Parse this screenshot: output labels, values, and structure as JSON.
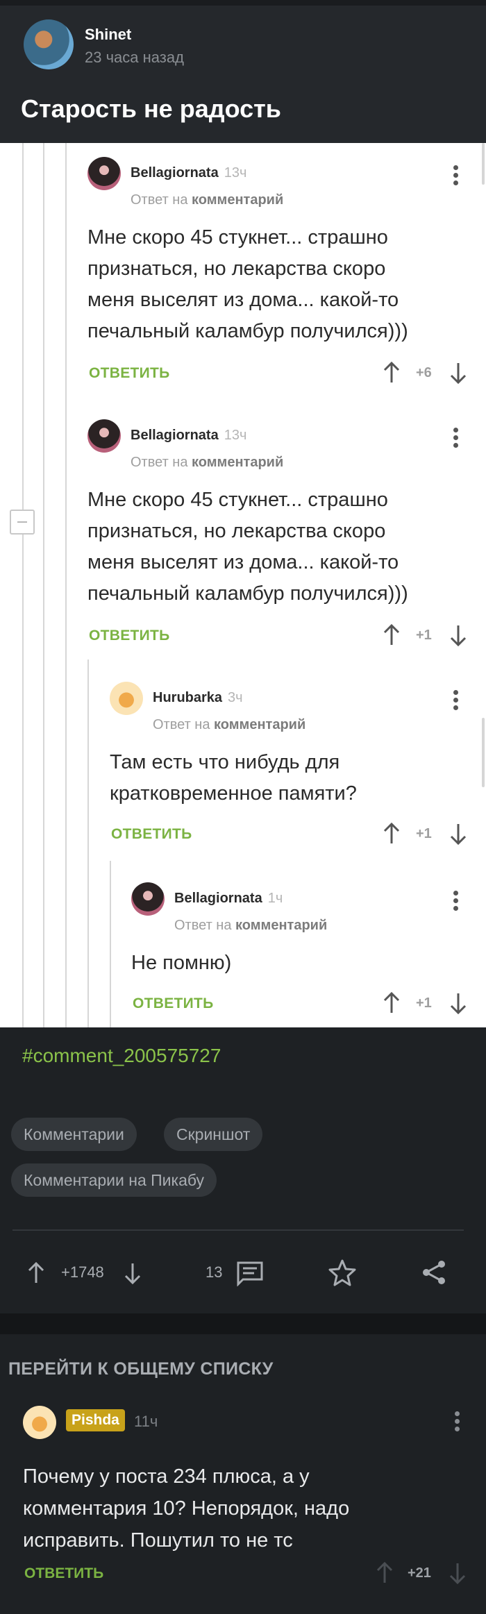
{
  "post": {
    "author": "Shinet",
    "time": "23 часа назад",
    "title": "Старость не радость"
  },
  "screenshot": {
    "reply_prefix": "Ответ на",
    "reply_target": "комментарий",
    "answer_label": "ОТВЕТИТЬ",
    "comments": [
      {
        "author": "Bellagiornata",
        "time": "13ч",
        "lines": [
          "Мне скоро 45 стукнет... страшно",
          "признаться, но лекарства скоро",
          "меня выселят из дома... какой-то",
          "печальный каламбур получился)))"
        ],
        "score": "+6"
      },
      {
        "author": "Bellagiornata",
        "time": "13ч",
        "lines": [
          "Мне скоро 45 стукнет... страшно",
          "признаться, но лекарства скоро",
          "меня выселят из дома... какой-то",
          "печальный каламбур получился)))"
        ],
        "score": "+1"
      },
      {
        "author": "Hurubarka",
        "time": "3ч",
        "lines": [
          "Там есть что нибудь для",
          "кратковременное памяти?"
        ],
        "score": "+1"
      },
      {
        "author": "Bellagiornata",
        "time": "1ч",
        "lines": [
          "Не помню)"
        ],
        "score": "+1"
      }
    ]
  },
  "hashtag": "#comment_200575727",
  "tags": [
    "Комментарии",
    "Скриншот",
    "Комментарии на Пикабу"
  ],
  "post_footer": {
    "rating": "+1748",
    "comments_count": "13"
  },
  "goto_list": "ПЕРЕЙТИ К ОБЩЕМУ СПИСКУ",
  "bottom_comment": {
    "author": "Pishda",
    "time": "11ч",
    "lines": [
      "Почему у поста 234 плюса, а у",
      "комментария 10? Непорядок, надо",
      "исправить. Пошутил то не тс"
    ],
    "answer_label": "ОТВЕТИТЬ",
    "score": "+21"
  },
  "colors": {
    "accent_green": "#7bb342",
    "hashtag_green": "#8bc34a",
    "author_badge": "#c8a21a",
    "background": "#1e2124",
    "header": "#25282c"
  }
}
